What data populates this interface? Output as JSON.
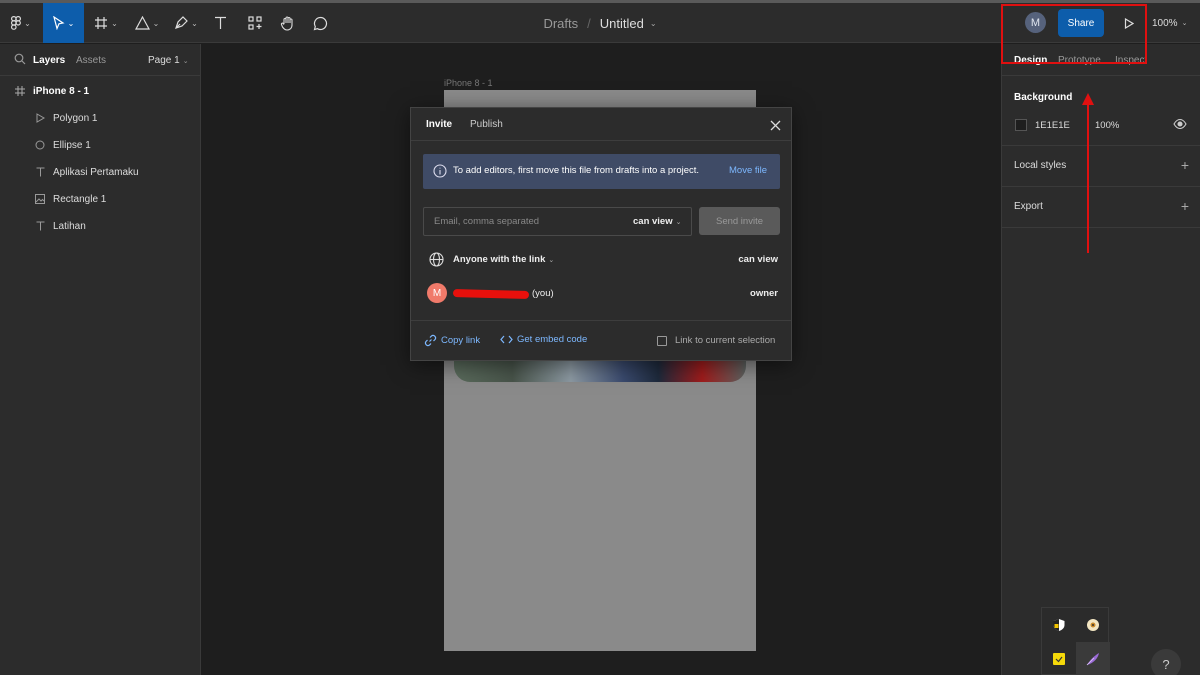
{
  "toolbar": {
    "breadcrumb_parent": "Drafts",
    "breadcrumb_separator": "/",
    "file_name": "Untitled",
    "avatar_initial": "M",
    "share_label": "Share",
    "zoom": "100%",
    "active_color": "#0d5dab"
  },
  "left_panel": {
    "tab_layers": "Layers",
    "tab_assets": "Assets",
    "page": "Page 1",
    "layers": [
      {
        "name": "iPhone 8 - 1",
        "icon": "frame-icon"
      },
      {
        "name": "Polygon 1",
        "icon": "polygon-icon"
      },
      {
        "name": "Ellipse 1",
        "icon": "ellipse-icon"
      },
      {
        "name": "Aplikasi Pertamaku",
        "icon": "text-icon"
      },
      {
        "name": "Rectangle 1",
        "icon": "image-icon"
      },
      {
        "name": "Latihan",
        "icon": "text-icon"
      }
    ]
  },
  "canvas": {
    "frame_label": "iPhone 8 - 1"
  },
  "modal": {
    "tab_invite": "Invite",
    "tab_publish": "Publish",
    "banner_text": "To add editors, first move this file from drafts into a project.",
    "banner_link": "Move file",
    "banner_color": "#3f4b66",
    "email_placeholder": "Email, comma separated",
    "email_permission": "can view",
    "send_label": "Send invite",
    "link_access": "Anyone with the link",
    "link_permission": "can view",
    "user_initial": "M",
    "user_suffix": "(you)",
    "user_role": "owner",
    "copy_link": "Copy link",
    "embed_code": "Get embed code",
    "link_selection": "Link to current selection"
  },
  "right_panel": {
    "tab_design": "Design",
    "tab_prototype": "Prototype",
    "tab_inspect": "Inspect",
    "background_title": "Background",
    "background_hex": "1E1E1E",
    "background_opacity": "100%",
    "local_styles": "Local styles",
    "export": "Export"
  },
  "annotation": {
    "color": "#e01010"
  },
  "help_label": "?"
}
